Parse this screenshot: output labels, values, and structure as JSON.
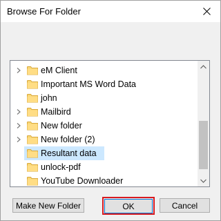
{
  "window": {
    "title": "Browse For Folder",
    "close_glyph": "✕"
  },
  "tree": {
    "items": [
      {
        "label": "eM Client",
        "expandable": true,
        "selected": false
      },
      {
        "label": "Important MS Word Data",
        "expandable": false,
        "selected": false
      },
      {
        "label": "john",
        "expandable": false,
        "selected": false
      },
      {
        "label": "Mailbird",
        "expandable": true,
        "selected": false
      },
      {
        "label": "New folder",
        "expandable": true,
        "selected": false
      },
      {
        "label": "New folder (2)",
        "expandable": true,
        "selected": false
      },
      {
        "label": "Resultant data",
        "expandable": false,
        "selected": true
      },
      {
        "label": "unlock-pdf",
        "expandable": false,
        "selected": false
      },
      {
        "label": "YouTube Downloader",
        "expandable": false,
        "selected": false
      }
    ],
    "scroll_position": 0.9
  },
  "buttons": {
    "make_new_folder": "Make New Folder",
    "ok": "OK",
    "cancel": "Cancel"
  },
  "colors": {
    "selection": "#cce8ff",
    "folder": "#f8d775",
    "ok_highlight": "#d7191f"
  }
}
